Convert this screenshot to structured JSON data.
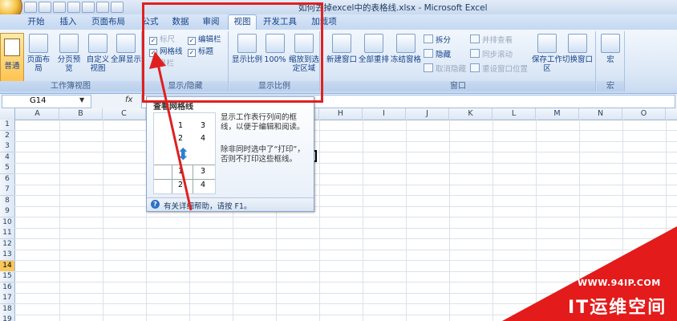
{
  "window": {
    "title": "如何去掉excel中的表格线.xlsx - Microsoft Excel"
  },
  "tabs": [
    {
      "label": "开始"
    },
    {
      "label": "插入"
    },
    {
      "label": "页面布局"
    },
    {
      "label": "公式"
    },
    {
      "label": "数据"
    },
    {
      "label": "审阅"
    },
    {
      "label": "视图",
      "active": true
    },
    {
      "label": "开发工具"
    },
    {
      "label": "加载项"
    }
  ],
  "ribbon": {
    "workbook_views": {
      "caption": "工作簿视图",
      "normal": "普通",
      "page_layout": "页面布局",
      "page_break": "分页预览",
      "custom": "自定义视图",
      "fullscreen": "全屏显示"
    },
    "show_hide": {
      "caption": "显示/隐藏",
      "ruler": {
        "label": "标尺",
        "checked": true,
        "enabled": false
      },
      "gridlines": {
        "label": "网格线",
        "checked": true
      },
      "message_bar": {
        "label": "息栏",
        "enabled": false
      },
      "formula_bar": {
        "label": "编辑栏",
        "checked": true
      },
      "headings": {
        "label": "标题",
        "checked": true
      }
    },
    "zoom": {
      "caption": "显示比例",
      "zoom": "显示比例",
      "hundred": "100%",
      "zoom_selection": "缩放到选定区域"
    },
    "window": {
      "caption": "窗口",
      "new_window": "新建窗口",
      "arrange_all": "全部重排",
      "freeze": "冻结窗格",
      "split": "拆分",
      "hide": "隐藏",
      "unhide": "取消隐藏",
      "side_by_side": "并排查看",
      "sync_scroll": "同步滚动",
      "reset_pos": "重设窗口位置",
      "save_workspace": "保存工作区",
      "switch_windows": "切换窗口"
    },
    "macros": {
      "caption": "宏",
      "macros": "宏"
    }
  },
  "formula_bar": {
    "name_box": "G14",
    "fx": "fx"
  },
  "grid": {
    "columns": [
      "A",
      "B",
      "C",
      "D",
      "E",
      "F",
      "G",
      "H",
      "I",
      "J",
      "K",
      "L",
      "M",
      "N",
      "O"
    ],
    "rows": [
      "1",
      "2",
      "3",
      "4",
      "5",
      "6",
      "7",
      "8",
      "9",
      "10",
      "11",
      "12",
      "13",
      "14",
      "15",
      "16",
      "17",
      "18",
      "19"
    ],
    "selected_row": "14"
  },
  "tooltip": {
    "title": "查看网格线",
    "description": "显示工作表行列间的框线，以便于编辑和阅读。",
    "note": "除非同时选中了“打印”，否则不打印这些框线。",
    "preview_numbers": [
      "1",
      "3",
      "2",
      "4",
      "1",
      "3",
      "2",
      "4"
    ],
    "help": "有关详细帮助，请按 F1。"
  },
  "watermark": {
    "url": "WWW.94IP.COM",
    "name": "IT运维空间"
  },
  "colors": {
    "annotation": "#e02020",
    "watermark": "#e31b1b"
  }
}
